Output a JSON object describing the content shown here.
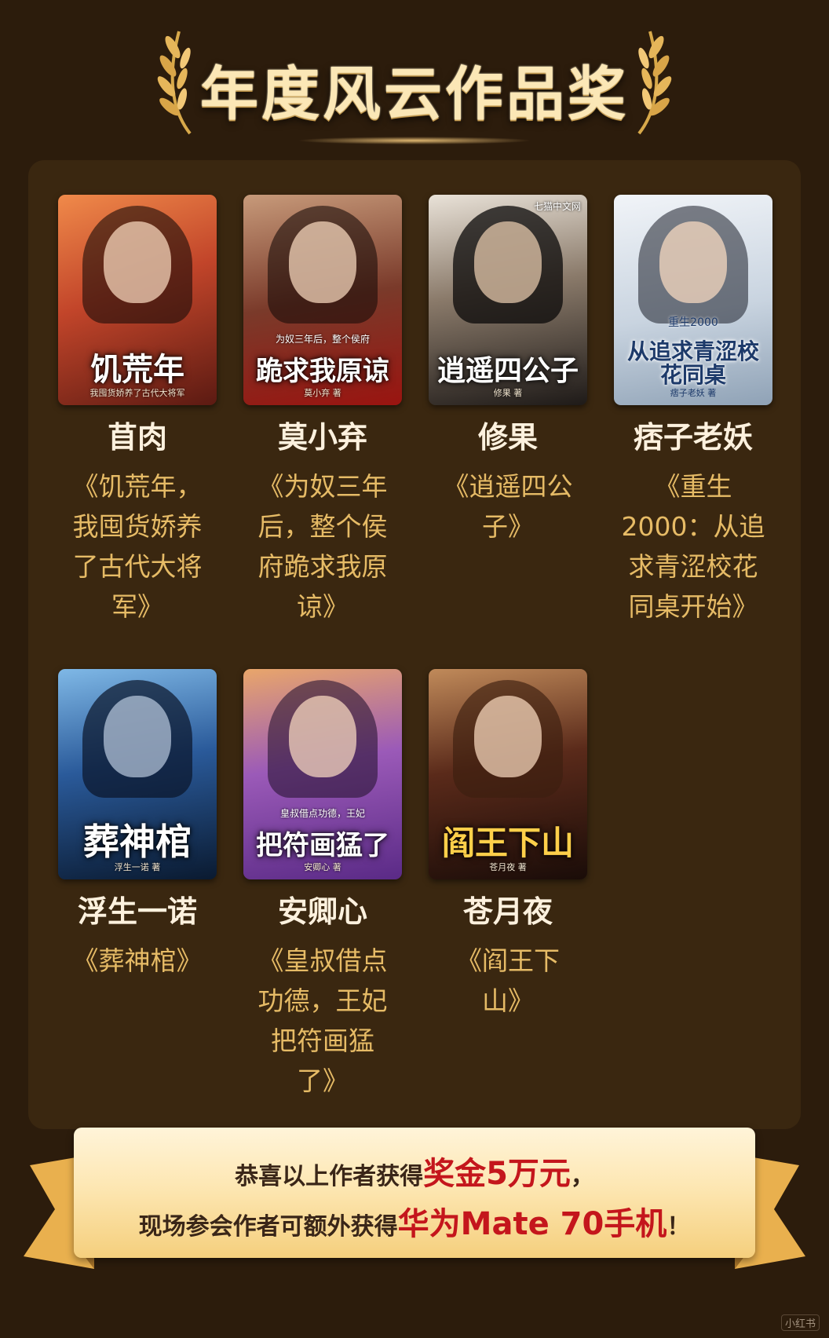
{
  "header": {
    "title": "年度风云作品奖"
  },
  "colors": {
    "background": "#2c1c0c",
    "panel": "#3a2710",
    "author_text": "#fdf1de",
    "book_text": "#e6bb66",
    "highlight_red": "#c4161c",
    "ribbon_gold": "#f5cf7d"
  },
  "works": [
    {
      "author": "苜肉",
      "book_lines": [
        "《饥荒年，",
        "我囤货娇养",
        "了古代大将",
        "军》"
      ],
      "cover": {
        "title": "饥荒年",
        "subtitle": "我囤货娇养了古代大将军",
        "tag": "",
        "logo": ""
      }
    },
    {
      "author": "莫小弃",
      "book_lines": [
        "《为奴三年",
        "后，整个侯",
        "府跪求我原",
        "谅》"
      ],
      "cover": {
        "title": "跪求我原谅",
        "subtitle": "莫小弃 著",
        "tag": "为奴三年后，整个侯府",
        "logo": ""
      }
    },
    {
      "author": "修果",
      "book_lines": [
        "《逍遥四公",
        "子》"
      ],
      "cover": {
        "title": "逍遥四公子",
        "subtitle": "修果 著",
        "tag": "",
        "logo": "七猫中文网"
      }
    },
    {
      "author": "痞子老妖",
      "book_lines": [
        "《重生",
        "2000：从追",
        "求青涩校花",
        "同桌开始》"
      ],
      "cover": {
        "title": "从追求青涩校花同桌",
        "subtitle": "痞子老妖 著",
        "tag": "重生2000",
        "logo": ""
      }
    },
    {
      "author": "浮生一诺",
      "book_lines": [
        "《葬神棺》"
      ],
      "cover": {
        "title": "葬神棺",
        "subtitle": "浮生一诺 著",
        "tag": "",
        "logo": ""
      }
    },
    {
      "author": "安卿心",
      "book_lines": [
        "《皇叔借点",
        "功德，王妃",
        "把符画猛",
        "了》"
      ],
      "cover": {
        "title": "把符画猛了",
        "subtitle": "安卿心 著",
        "tag": "皇叔借点功德，王妃",
        "logo": ""
      }
    },
    {
      "author": "苍月夜",
      "book_lines": [
        "《阎王下",
        "山》"
      ],
      "cover": {
        "title": "阎王下山",
        "subtitle": "苍月夜 著",
        "tag": "",
        "logo": ""
      }
    }
  ],
  "banner": {
    "line1_prefix": "恭喜以上作者获得",
    "line1_highlight": "奖金5万元",
    "line1_suffix": "，",
    "line2_prefix": "现场参会作者可额外获得",
    "line2_highlight": "华为Mate 70手机",
    "line2_suffix": "！"
  },
  "watermark": "小红书"
}
